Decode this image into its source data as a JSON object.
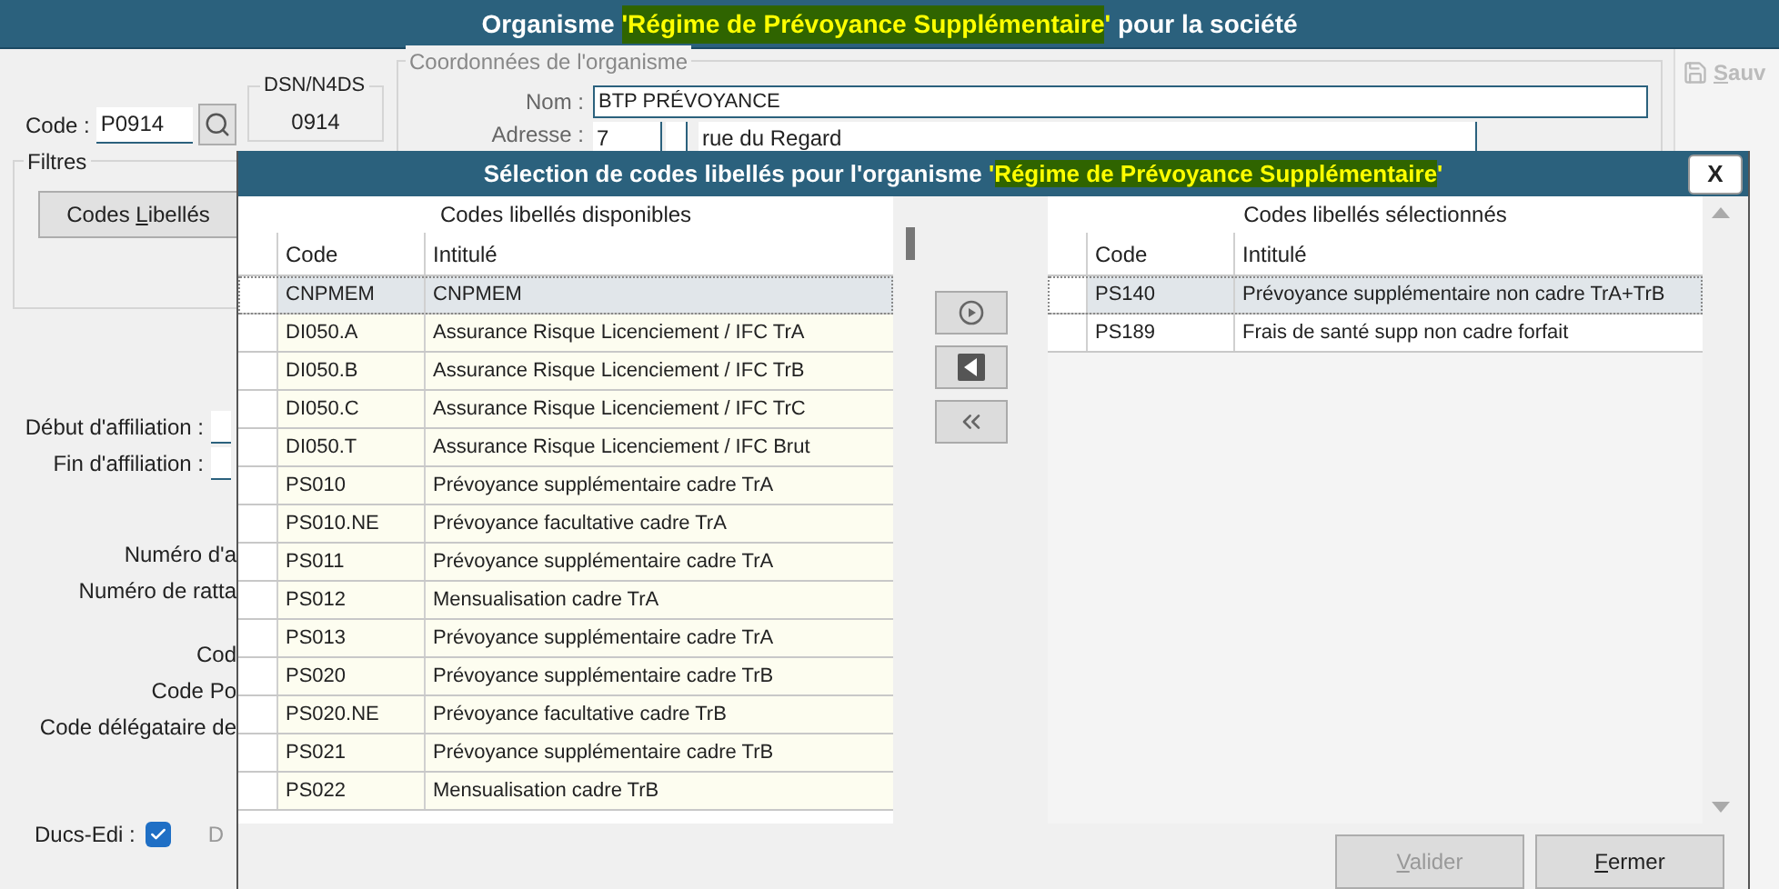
{
  "main_window": {
    "title_parts": [
      {
        "kind": "plain",
        "text": "Organisme "
      },
      {
        "kind": "marked",
        "text": "'Régime de Prévoyance Supplémentaire"
      },
      {
        "kind": "quoted",
        "text": "' "
      },
      {
        "kind": "plain",
        "text": "pour la société"
      }
    ],
    "save_button": {
      "accel": "S",
      "after": "auv",
      "disabled": true
    }
  },
  "form": {
    "code": {
      "label": "Code :",
      "value": "P0914"
    },
    "dsn": {
      "legend": "DSN/N4DS",
      "value": "0914"
    },
    "coordonnees": {
      "legend": "Coordonnées de l'organisme",
      "nom_label": "Nom :",
      "nom_value": "BTP PRÉVOYANCE",
      "adresse_label": "Adresse :",
      "adresse_number": "7",
      "adresse_street": "rue du Regard"
    },
    "filtres": {
      "legend": "Filtres",
      "button": {
        "before": "Codes ",
        "accel": "L",
        "after": "ibellés"
      }
    },
    "date_labels": [
      "Début d'affiliation :",
      "Fin d'affiliation :"
    ],
    "numero_labels": [
      "Numéro d'a",
      "Numéro de ratta"
    ],
    "code_labels": [
      "Cod",
      "Code Po",
      "Code délégataire de"
    ],
    "ducs_edi": {
      "label": "Ducs-Edi :",
      "checked": true,
      "next_label": "D"
    }
  },
  "dialog": {
    "title_parts": [
      {
        "kind": "plain",
        "text": "Sélection de codes libellés pour l'organisme "
      },
      {
        "kind": "quoted",
        "text": "'"
      },
      {
        "kind": "marked",
        "text": "Régime de Prévoyance Supplémentaire"
      },
      {
        "kind": "quoted",
        "text": "'"
      }
    ],
    "close": "X",
    "available": {
      "title": "Codes libellés disponibles",
      "columns": [
        "Code",
        "Intitulé"
      ],
      "rows": [
        {
          "code": "CNPMEM",
          "label": "CNPMEM",
          "selected": true
        },
        {
          "code": "DI050.A",
          "label": "Assurance Risque Licenciement / IFC TrA",
          "selected": false
        },
        {
          "code": "DI050.B",
          "label": "Assurance Risque Licenciement / IFC TrB",
          "selected": false
        },
        {
          "code": "DI050.C",
          "label": "Assurance Risque Licenciement / IFC TrC",
          "selected": false
        },
        {
          "code": "DI050.T",
          "label": "Assurance Risque Licenciement / IFC Brut",
          "selected": false
        },
        {
          "code": "PS010",
          "label": "Prévoyance supplémentaire cadre TrA",
          "selected": false
        },
        {
          "code": "PS010.NE",
          "label": "Prévoyance facultative cadre TrA",
          "selected": false
        },
        {
          "code": "PS011",
          "label": "Prévoyance supplémentaire cadre TrA",
          "selected": false
        },
        {
          "code": "PS012",
          "label": "Mensualisation cadre TrA",
          "selected": false
        },
        {
          "code": "PS013",
          "label": "Prévoyance supplémentaire cadre TrA",
          "selected": false
        },
        {
          "code": "PS020",
          "label": "Prévoyance supplémentaire cadre TrB",
          "selected": false
        },
        {
          "code": "PS020.NE",
          "label": "Prévoyance facultative cadre TrB",
          "selected": false
        },
        {
          "code": "PS021",
          "label": "Prévoyance supplémentaire cadre TrB",
          "selected": false
        },
        {
          "code": "PS022",
          "label": "Mensualisation cadre TrB",
          "selected": false
        }
      ]
    },
    "selected": {
      "title": "Codes libellés sélectionnés",
      "columns": [
        "Code",
        "Intitulé"
      ],
      "rows": [
        {
          "code": "PS140",
          "label": "Prévoyance supplémentaire non cadre TrA+TrB",
          "selected": true
        },
        {
          "code": "PS189",
          "label": "Frais de santé supp non cadre forfait",
          "selected": false
        }
      ]
    },
    "buttons": [
      {
        "accel": "V",
        "after": "alider",
        "disabled": true
      },
      {
        "accel": "F",
        "after": "ermer",
        "disabled": false
      }
    ]
  }
}
